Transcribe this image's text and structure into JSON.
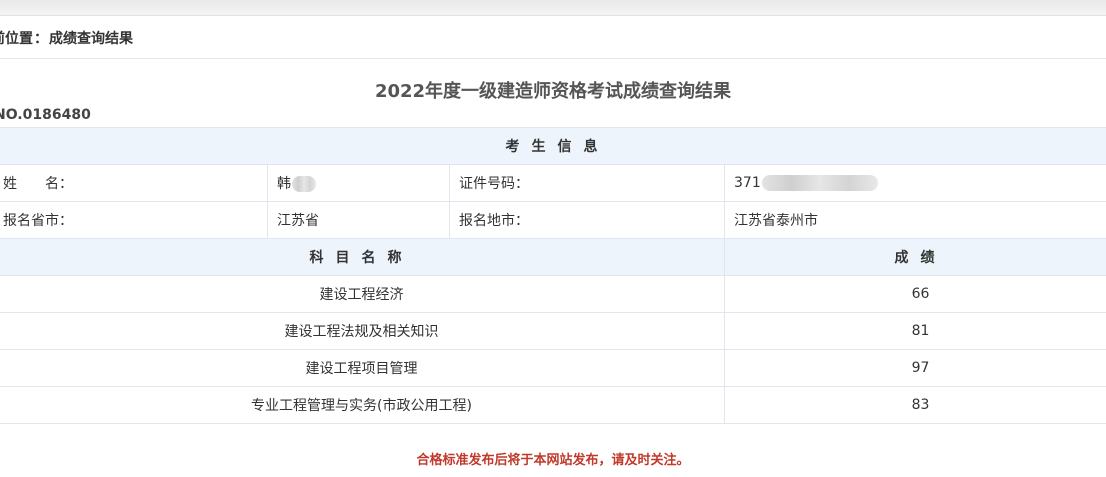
{
  "breadcrumb": {
    "label": "前位置",
    "separator": "：",
    "current": "成绩查询结果"
  },
  "title": "2022年度一级建造师资格考试成绩查询结果",
  "serial": "NO.0186480",
  "candidate": {
    "section_title": "考生信息",
    "name_label": "姓　　名：",
    "name_value": "韩",
    "id_label": "证件号码：",
    "id_value": "371",
    "province_label": "报名省市：",
    "province_value": "江苏省",
    "city_label": "报名地市：",
    "city_value": "江苏省泰州市"
  },
  "scores": {
    "subject_header": "科目名称",
    "score_header": "成绩",
    "rows": [
      {
        "subject": "建设工程经济",
        "score": "66"
      },
      {
        "subject": "建设工程法规及相关知识",
        "score": "81"
      },
      {
        "subject": "建设工程项目管理",
        "score": "97"
      },
      {
        "subject": "专业工程管理与实务(市政公用工程)",
        "score": "83"
      }
    ]
  },
  "footnote": "合格标准发布后将于本网站发布，请及时关注。",
  "colors": {
    "header_bg": "#eef4fc",
    "border": "#dfe6ee",
    "notice": "#c0392b"
  }
}
